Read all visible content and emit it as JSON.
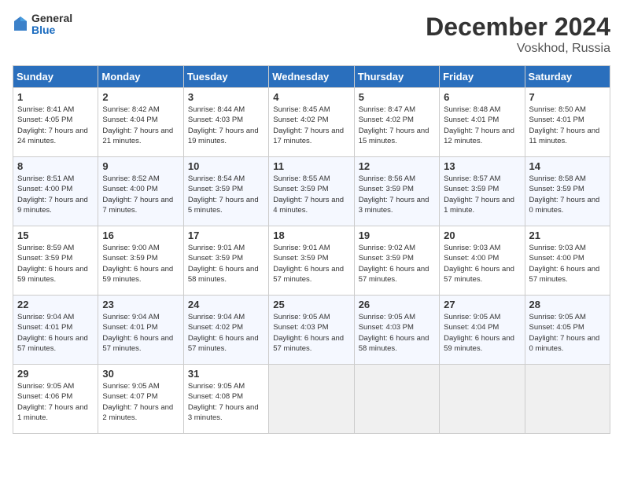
{
  "header": {
    "logo": {
      "general": "General",
      "blue": "Blue"
    },
    "title": "December 2024",
    "location": "Voskhod, Russia"
  },
  "weekdays": [
    "Sunday",
    "Monday",
    "Tuesday",
    "Wednesday",
    "Thursday",
    "Friday",
    "Saturday"
  ],
  "weeks": [
    [
      {
        "day": "1",
        "sunrise": "8:41 AM",
        "sunset": "4:05 PM",
        "daylight": "7 hours and 24 minutes."
      },
      {
        "day": "2",
        "sunrise": "8:42 AM",
        "sunset": "4:04 PM",
        "daylight": "7 hours and 21 minutes."
      },
      {
        "day": "3",
        "sunrise": "8:44 AM",
        "sunset": "4:03 PM",
        "daylight": "7 hours and 19 minutes."
      },
      {
        "day": "4",
        "sunrise": "8:45 AM",
        "sunset": "4:02 PM",
        "daylight": "7 hours and 17 minutes."
      },
      {
        "day": "5",
        "sunrise": "8:47 AM",
        "sunset": "4:02 PM",
        "daylight": "7 hours and 15 minutes."
      },
      {
        "day": "6",
        "sunrise": "8:48 AM",
        "sunset": "4:01 PM",
        "daylight": "7 hours and 12 minutes."
      },
      {
        "day": "7",
        "sunrise": "8:50 AM",
        "sunset": "4:01 PM",
        "daylight": "7 hours and 11 minutes."
      }
    ],
    [
      {
        "day": "8",
        "sunrise": "8:51 AM",
        "sunset": "4:00 PM",
        "daylight": "7 hours and 9 minutes."
      },
      {
        "day": "9",
        "sunrise": "8:52 AM",
        "sunset": "4:00 PM",
        "daylight": "7 hours and 7 minutes."
      },
      {
        "day": "10",
        "sunrise": "8:54 AM",
        "sunset": "3:59 PM",
        "daylight": "7 hours and 5 minutes."
      },
      {
        "day": "11",
        "sunrise": "8:55 AM",
        "sunset": "3:59 PM",
        "daylight": "7 hours and 4 minutes."
      },
      {
        "day": "12",
        "sunrise": "8:56 AM",
        "sunset": "3:59 PM",
        "daylight": "7 hours and 3 minutes."
      },
      {
        "day": "13",
        "sunrise": "8:57 AM",
        "sunset": "3:59 PM",
        "daylight": "7 hours and 1 minute."
      },
      {
        "day": "14",
        "sunrise": "8:58 AM",
        "sunset": "3:59 PM",
        "daylight": "7 hours and 0 minutes."
      }
    ],
    [
      {
        "day": "15",
        "sunrise": "8:59 AM",
        "sunset": "3:59 PM",
        "daylight": "6 hours and 59 minutes."
      },
      {
        "day": "16",
        "sunrise": "9:00 AM",
        "sunset": "3:59 PM",
        "daylight": "6 hours and 59 minutes."
      },
      {
        "day": "17",
        "sunrise": "9:01 AM",
        "sunset": "3:59 PM",
        "daylight": "6 hours and 58 minutes."
      },
      {
        "day": "18",
        "sunrise": "9:01 AM",
        "sunset": "3:59 PM",
        "daylight": "6 hours and 57 minutes."
      },
      {
        "day": "19",
        "sunrise": "9:02 AM",
        "sunset": "3:59 PM",
        "daylight": "6 hours and 57 minutes."
      },
      {
        "day": "20",
        "sunrise": "9:03 AM",
        "sunset": "4:00 PM",
        "daylight": "6 hours and 57 minutes."
      },
      {
        "day": "21",
        "sunrise": "9:03 AM",
        "sunset": "4:00 PM",
        "daylight": "6 hours and 57 minutes."
      }
    ],
    [
      {
        "day": "22",
        "sunrise": "9:04 AM",
        "sunset": "4:01 PM",
        "daylight": "6 hours and 57 minutes."
      },
      {
        "day": "23",
        "sunrise": "9:04 AM",
        "sunset": "4:01 PM",
        "daylight": "6 hours and 57 minutes."
      },
      {
        "day": "24",
        "sunrise": "9:04 AM",
        "sunset": "4:02 PM",
        "daylight": "6 hours and 57 minutes."
      },
      {
        "day": "25",
        "sunrise": "9:05 AM",
        "sunset": "4:03 PM",
        "daylight": "6 hours and 57 minutes."
      },
      {
        "day": "26",
        "sunrise": "9:05 AM",
        "sunset": "4:03 PM",
        "daylight": "6 hours and 58 minutes."
      },
      {
        "day": "27",
        "sunrise": "9:05 AM",
        "sunset": "4:04 PM",
        "daylight": "6 hours and 59 minutes."
      },
      {
        "day": "28",
        "sunrise": "9:05 AM",
        "sunset": "4:05 PM",
        "daylight": "7 hours and 0 minutes."
      }
    ],
    [
      {
        "day": "29",
        "sunrise": "9:05 AM",
        "sunset": "4:06 PM",
        "daylight": "7 hours and 1 minute."
      },
      {
        "day": "30",
        "sunrise": "9:05 AM",
        "sunset": "4:07 PM",
        "daylight": "7 hours and 2 minutes."
      },
      {
        "day": "31",
        "sunrise": "9:05 AM",
        "sunset": "4:08 PM",
        "daylight": "7 hours and 3 minutes."
      },
      null,
      null,
      null,
      null
    ]
  ]
}
